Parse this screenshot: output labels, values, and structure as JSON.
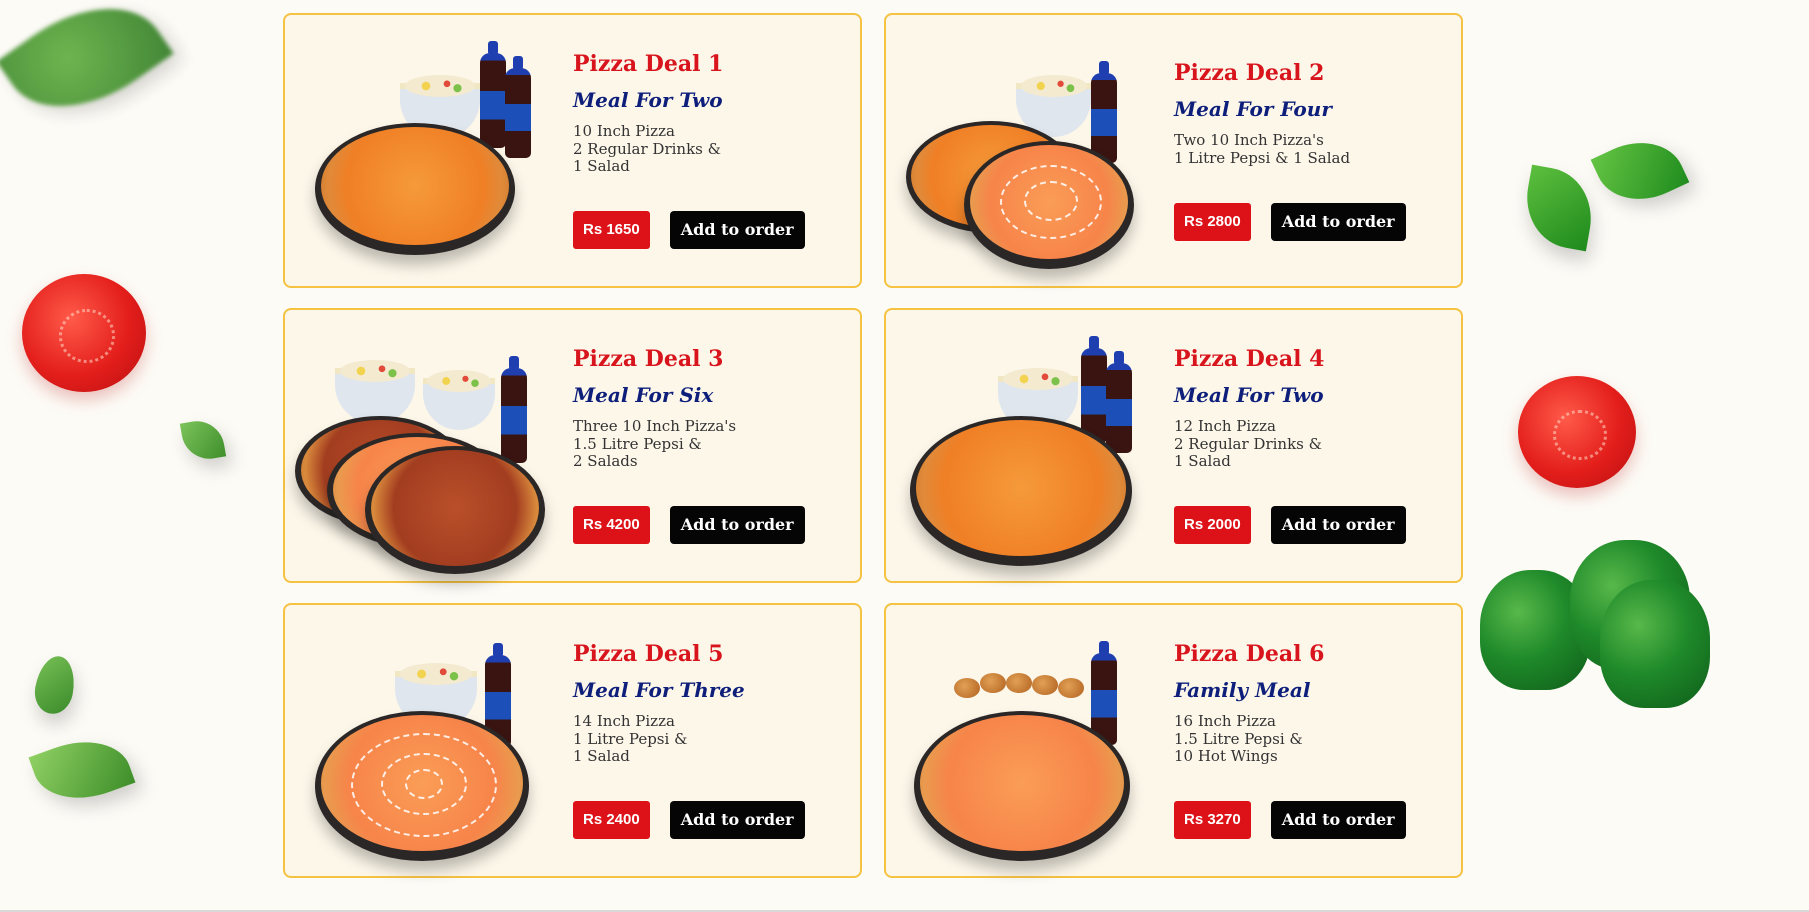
{
  "colors": {
    "accent_red": "#d8141d",
    "subtitle_navy": "#0d1f7a",
    "card_border": "#f5c242",
    "card_bg": "#fdf7ea"
  },
  "decorations": [
    "basil-leaf",
    "tomato",
    "green-bell-pepper"
  ],
  "deals": [
    {
      "title": "Pizza Deal 1",
      "subtitle": "Meal For Two",
      "lines": [
        "10 Inch Pizza",
        "2 Regular Drinks &",
        "1 Salad"
      ],
      "price": "Rs 1650",
      "button": "Add to order"
    },
    {
      "title": "Pizza Deal 2",
      "subtitle": "Meal For Four",
      "lines": [
        "Two 10 Inch Pizza's",
        "1 Litre Pepsi & 1 Salad"
      ],
      "price": "Rs 2800",
      "button": "Add to order"
    },
    {
      "title": "Pizza Deal 3",
      "subtitle": "Meal For Six",
      "lines": [
        "Three 10 Inch Pizza's",
        "1.5 Litre Pepsi &",
        "2 Salads"
      ],
      "price": "Rs 4200",
      "button": "Add to order"
    },
    {
      "title": "Pizza Deal 4",
      "subtitle": "Meal For Two",
      "lines": [
        "12 Inch Pizza",
        "2 Regular Drinks &",
        "1 Salad"
      ],
      "price": "Rs 2000",
      "button": "Add to order"
    },
    {
      "title": "Pizza Deal 5",
      "subtitle": "Meal For Three",
      "lines": [
        "14 Inch Pizza",
        "1 Litre Pepsi &",
        "1 Salad"
      ],
      "price": "Rs 2400",
      "button": "Add to order"
    },
    {
      "title": "Pizza Deal 6",
      "subtitle": "Family Meal",
      "lines": [
        "16 Inch Pizza",
        "1.5 Litre Pepsi &",
        "10 Hot Wings"
      ],
      "price": "Rs 3270",
      "button": "Add to order"
    }
  ]
}
